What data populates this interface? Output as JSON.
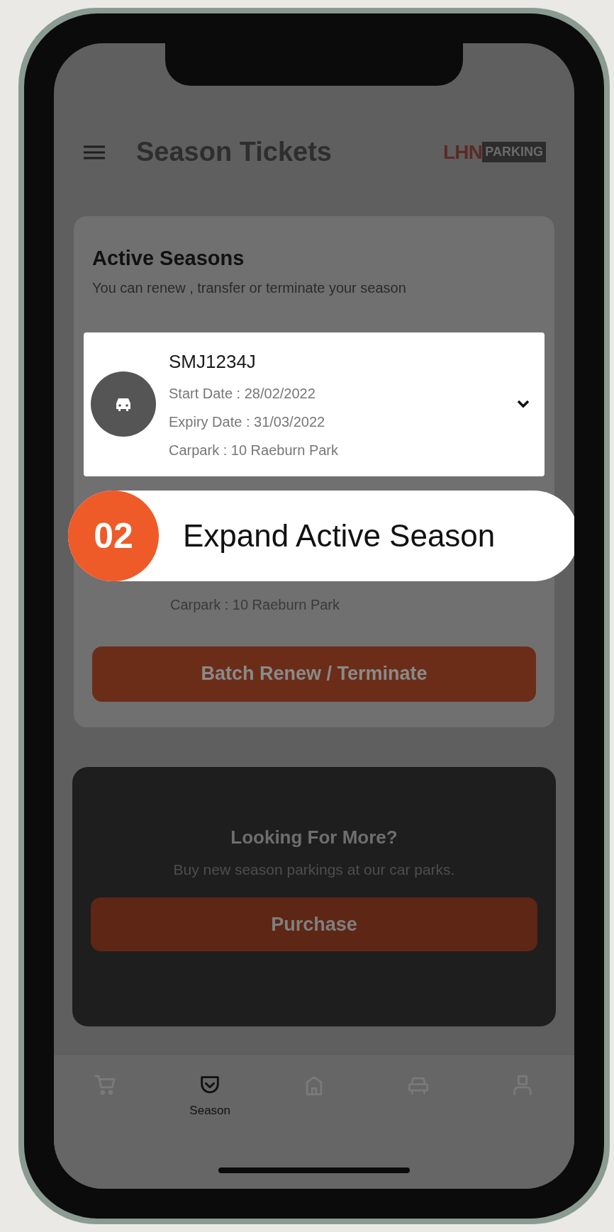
{
  "header": {
    "title": "Season Tickets",
    "logo": {
      "part_1": "LHN",
      "part_2": "PARKING"
    }
  },
  "active_seasons": {
    "title": "Active Seasons",
    "subtitle": "You can renew , transfer or terminate your season",
    "ticket": {
      "plate": "SMJ1234J",
      "start": "Start Date : 28/02/2022",
      "expiry": "Expiry Date : 31/03/2022",
      "carpark": "Carpark : 10 Raeburn Park",
      "expanded": false
    },
    "hidden_carpark": "Carpark : 10 Raeburn Park",
    "button": "Batch Renew / Terminate"
  },
  "callout": {
    "number": "02",
    "text": "Expand Active Season"
  },
  "promo": {
    "title": "Looking For More?",
    "text": "Buy new season parkings at our car parks.",
    "button": "Purchase"
  },
  "nav": [
    {
      "kind": "cart",
      "selected": false
    },
    {
      "kind": "season",
      "label": "Season",
      "selected": true
    },
    {
      "kind": "home",
      "selected": false
    },
    {
      "kind": "car",
      "selected": false
    },
    {
      "kind": "account",
      "selected": false
    }
  ]
}
